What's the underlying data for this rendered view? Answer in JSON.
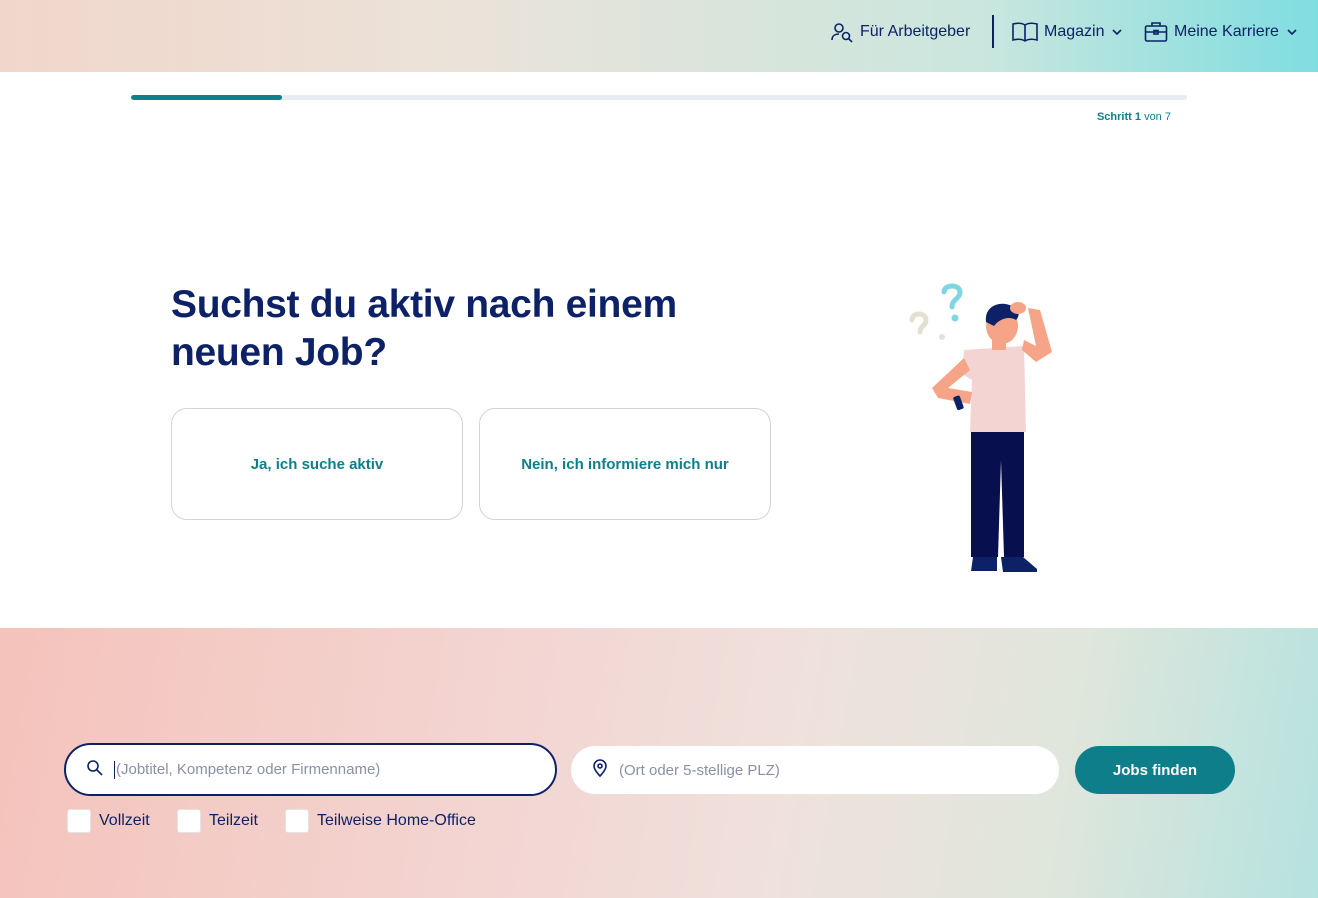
{
  "header": {
    "employers": {
      "label": "Für Arbeitgeber",
      "icon": "user-search-icon"
    },
    "magazine": {
      "label": "Magazin",
      "icon": "book-icon"
    },
    "career": {
      "label": "Meine Karriere",
      "icon": "briefcase-icon"
    }
  },
  "progress": {
    "fraction": 0.142857,
    "step_word": "Schritt",
    "current": "1",
    "of_word": "von",
    "total": "7"
  },
  "question": {
    "title": "Suchst du aktiv nach einem neuen Job?",
    "answers": [
      "Ja, ich suche aktiv",
      "Nein, ich informiere mich nur"
    ]
  },
  "search": {
    "job_placeholder": "(Jobtitel, Kompetenz oder Firmenname)",
    "location_placeholder": "(Ort oder 5-stellige PLZ)",
    "button_label": "Jobs finden",
    "filters": [
      "Vollzeit",
      "Teilzeit",
      "Teilweise Home-Office"
    ]
  },
  "colors": {
    "navy": "#0d2266",
    "teal": "#0e7f8a",
    "track": "#e7ecf3"
  }
}
